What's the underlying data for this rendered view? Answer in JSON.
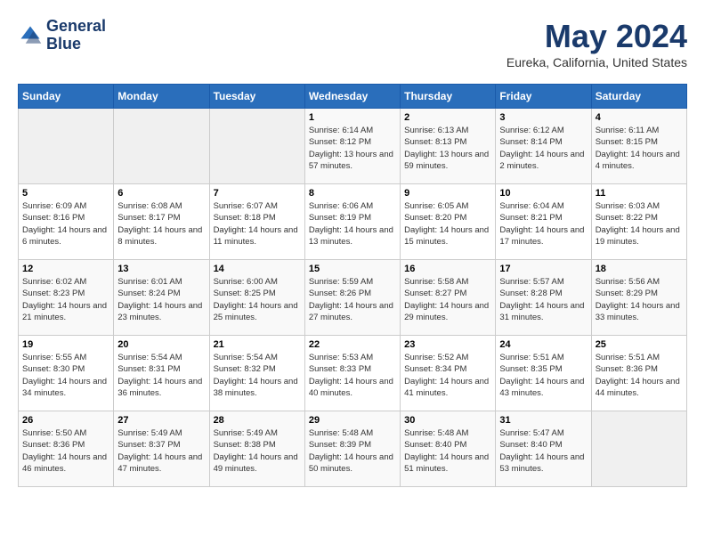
{
  "header": {
    "logo_line1": "General",
    "logo_line2": "Blue",
    "month_title": "May 2024",
    "location": "Eureka, California, United States"
  },
  "weekdays": [
    "Sunday",
    "Monday",
    "Tuesday",
    "Wednesday",
    "Thursday",
    "Friday",
    "Saturday"
  ],
  "weeks": [
    [
      {
        "day": "",
        "empty": true
      },
      {
        "day": "",
        "empty": true
      },
      {
        "day": "",
        "empty": true
      },
      {
        "day": "1",
        "sunrise": "Sunrise: 6:14 AM",
        "sunset": "Sunset: 8:12 PM",
        "daylight": "Daylight: 13 hours and 57 minutes."
      },
      {
        "day": "2",
        "sunrise": "Sunrise: 6:13 AM",
        "sunset": "Sunset: 8:13 PM",
        "daylight": "Daylight: 13 hours and 59 minutes."
      },
      {
        "day": "3",
        "sunrise": "Sunrise: 6:12 AM",
        "sunset": "Sunset: 8:14 PM",
        "daylight": "Daylight: 14 hours and 2 minutes."
      },
      {
        "day": "4",
        "sunrise": "Sunrise: 6:11 AM",
        "sunset": "Sunset: 8:15 PM",
        "daylight": "Daylight: 14 hours and 4 minutes."
      }
    ],
    [
      {
        "day": "5",
        "sunrise": "Sunrise: 6:09 AM",
        "sunset": "Sunset: 8:16 PM",
        "daylight": "Daylight: 14 hours and 6 minutes."
      },
      {
        "day": "6",
        "sunrise": "Sunrise: 6:08 AM",
        "sunset": "Sunset: 8:17 PM",
        "daylight": "Daylight: 14 hours and 8 minutes."
      },
      {
        "day": "7",
        "sunrise": "Sunrise: 6:07 AM",
        "sunset": "Sunset: 8:18 PM",
        "daylight": "Daylight: 14 hours and 11 minutes."
      },
      {
        "day": "8",
        "sunrise": "Sunrise: 6:06 AM",
        "sunset": "Sunset: 8:19 PM",
        "daylight": "Daylight: 14 hours and 13 minutes."
      },
      {
        "day": "9",
        "sunrise": "Sunrise: 6:05 AM",
        "sunset": "Sunset: 8:20 PM",
        "daylight": "Daylight: 14 hours and 15 minutes."
      },
      {
        "day": "10",
        "sunrise": "Sunrise: 6:04 AM",
        "sunset": "Sunset: 8:21 PM",
        "daylight": "Daylight: 14 hours and 17 minutes."
      },
      {
        "day": "11",
        "sunrise": "Sunrise: 6:03 AM",
        "sunset": "Sunset: 8:22 PM",
        "daylight": "Daylight: 14 hours and 19 minutes."
      }
    ],
    [
      {
        "day": "12",
        "sunrise": "Sunrise: 6:02 AM",
        "sunset": "Sunset: 8:23 PM",
        "daylight": "Daylight: 14 hours and 21 minutes."
      },
      {
        "day": "13",
        "sunrise": "Sunrise: 6:01 AM",
        "sunset": "Sunset: 8:24 PM",
        "daylight": "Daylight: 14 hours and 23 minutes."
      },
      {
        "day": "14",
        "sunrise": "Sunrise: 6:00 AM",
        "sunset": "Sunset: 8:25 PM",
        "daylight": "Daylight: 14 hours and 25 minutes."
      },
      {
        "day": "15",
        "sunrise": "Sunrise: 5:59 AM",
        "sunset": "Sunset: 8:26 PM",
        "daylight": "Daylight: 14 hours and 27 minutes."
      },
      {
        "day": "16",
        "sunrise": "Sunrise: 5:58 AM",
        "sunset": "Sunset: 8:27 PM",
        "daylight": "Daylight: 14 hours and 29 minutes."
      },
      {
        "day": "17",
        "sunrise": "Sunrise: 5:57 AM",
        "sunset": "Sunset: 8:28 PM",
        "daylight": "Daylight: 14 hours and 31 minutes."
      },
      {
        "day": "18",
        "sunrise": "Sunrise: 5:56 AM",
        "sunset": "Sunset: 8:29 PM",
        "daylight": "Daylight: 14 hours and 33 minutes."
      }
    ],
    [
      {
        "day": "19",
        "sunrise": "Sunrise: 5:55 AM",
        "sunset": "Sunset: 8:30 PM",
        "daylight": "Daylight: 14 hours and 34 minutes."
      },
      {
        "day": "20",
        "sunrise": "Sunrise: 5:54 AM",
        "sunset": "Sunset: 8:31 PM",
        "daylight": "Daylight: 14 hours and 36 minutes."
      },
      {
        "day": "21",
        "sunrise": "Sunrise: 5:54 AM",
        "sunset": "Sunset: 8:32 PM",
        "daylight": "Daylight: 14 hours and 38 minutes."
      },
      {
        "day": "22",
        "sunrise": "Sunrise: 5:53 AM",
        "sunset": "Sunset: 8:33 PM",
        "daylight": "Daylight: 14 hours and 40 minutes."
      },
      {
        "day": "23",
        "sunrise": "Sunrise: 5:52 AM",
        "sunset": "Sunset: 8:34 PM",
        "daylight": "Daylight: 14 hours and 41 minutes."
      },
      {
        "day": "24",
        "sunrise": "Sunrise: 5:51 AM",
        "sunset": "Sunset: 8:35 PM",
        "daylight": "Daylight: 14 hours and 43 minutes."
      },
      {
        "day": "25",
        "sunrise": "Sunrise: 5:51 AM",
        "sunset": "Sunset: 8:36 PM",
        "daylight": "Daylight: 14 hours and 44 minutes."
      }
    ],
    [
      {
        "day": "26",
        "sunrise": "Sunrise: 5:50 AM",
        "sunset": "Sunset: 8:36 PM",
        "daylight": "Daylight: 14 hours and 46 minutes."
      },
      {
        "day": "27",
        "sunrise": "Sunrise: 5:49 AM",
        "sunset": "Sunset: 8:37 PM",
        "daylight": "Daylight: 14 hours and 47 minutes."
      },
      {
        "day": "28",
        "sunrise": "Sunrise: 5:49 AM",
        "sunset": "Sunset: 8:38 PM",
        "daylight": "Daylight: 14 hours and 49 minutes."
      },
      {
        "day": "29",
        "sunrise": "Sunrise: 5:48 AM",
        "sunset": "Sunset: 8:39 PM",
        "daylight": "Daylight: 14 hours and 50 minutes."
      },
      {
        "day": "30",
        "sunrise": "Sunrise: 5:48 AM",
        "sunset": "Sunset: 8:40 PM",
        "daylight": "Daylight: 14 hours and 51 minutes."
      },
      {
        "day": "31",
        "sunrise": "Sunrise: 5:47 AM",
        "sunset": "Sunset: 8:40 PM",
        "daylight": "Daylight: 14 hours and 53 minutes."
      },
      {
        "day": "",
        "empty": true
      }
    ]
  ]
}
